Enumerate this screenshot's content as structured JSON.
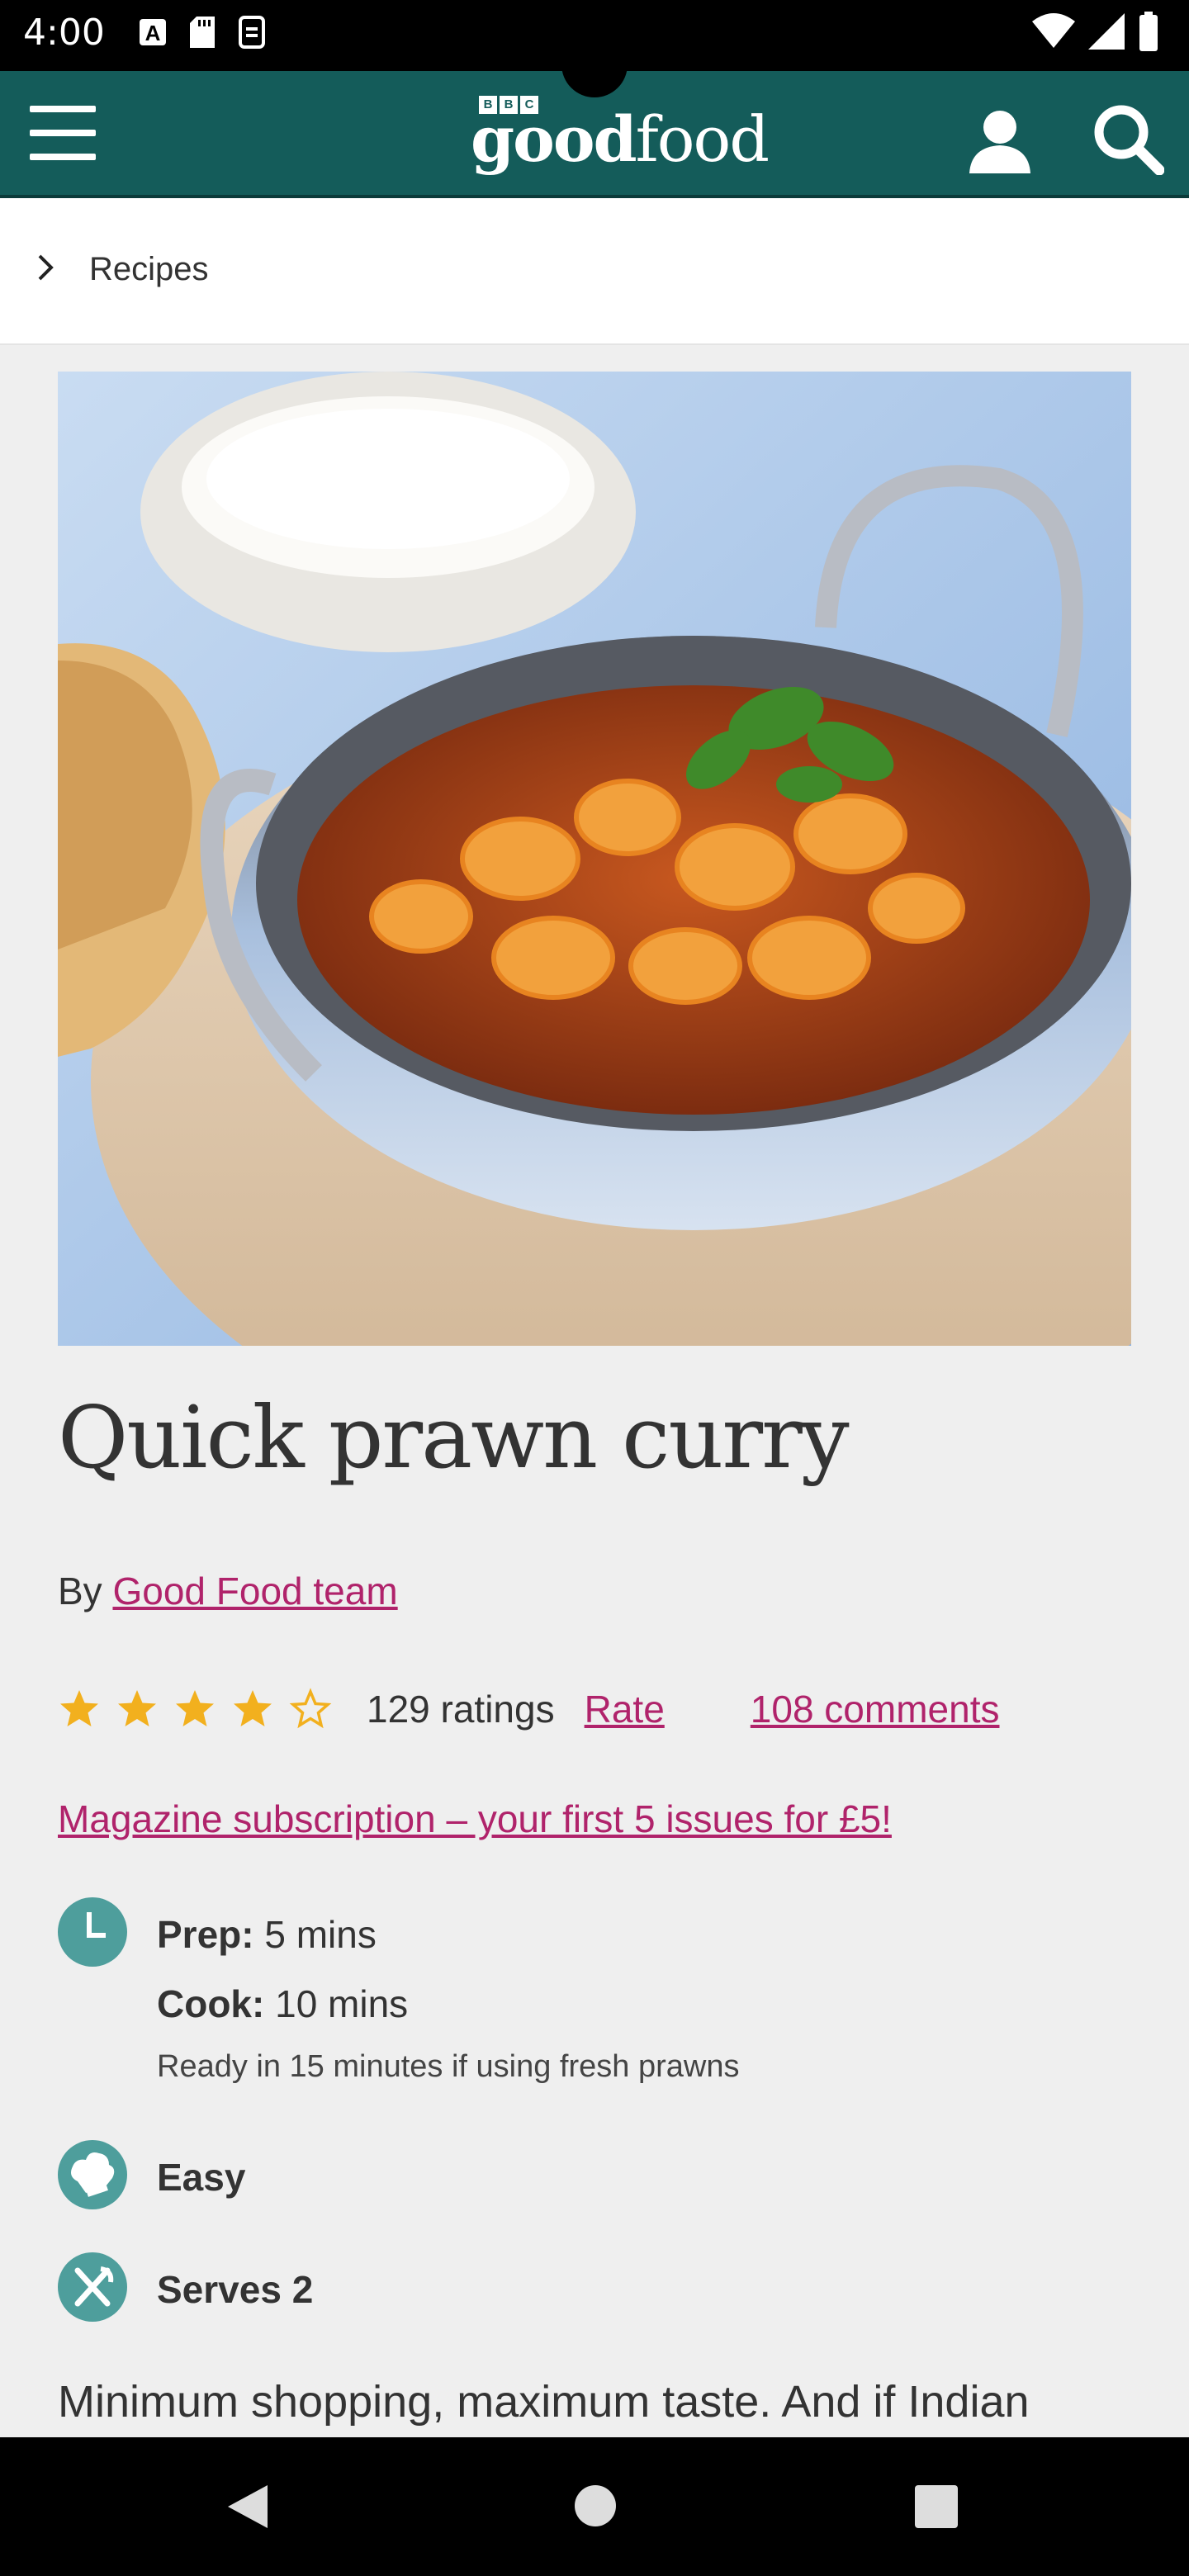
{
  "status_bar": {
    "time": "4:00",
    "icons_left": [
      "notification-a-icon",
      "sd-card-icon",
      "data-saver-icon"
    ],
    "icons_right": [
      "wifi-icon",
      "cell-signal-icon",
      "battery-icon"
    ]
  },
  "header": {
    "logo_bbc": [
      "B",
      "B",
      "C"
    ],
    "logo_good": "good",
    "logo_food": "food",
    "background_color": "#145c5a",
    "icons": [
      "menu-icon",
      "user-icon",
      "search-icon"
    ]
  },
  "breadcrumb": {
    "label": "Recipes"
  },
  "recipe": {
    "title": "Quick prawn curry",
    "by_prefix": "By ",
    "author": "Good Food team",
    "rating_stars": 4,
    "rating_max": 5,
    "ratings_count": "129 ratings",
    "rate_label": "Rate",
    "comments_label": "108 comments",
    "promo": "Magazine subscription – your first 5 issues for £5!",
    "prep_label": "Prep:",
    "prep_value": "5 mins",
    "cook_label": "Cook:",
    "cook_value": "10 mins",
    "note": "Ready in 15 minutes if using fresh prawns",
    "difficulty": "Easy",
    "serves": "Serves 2",
    "intro": "Minimum shopping, maximum taste. And if Indian"
  },
  "colors": {
    "accent": "#b0236b",
    "teal": "#145c5a",
    "icon_teal": "#4e9e9c",
    "star": "#f2b01e"
  }
}
